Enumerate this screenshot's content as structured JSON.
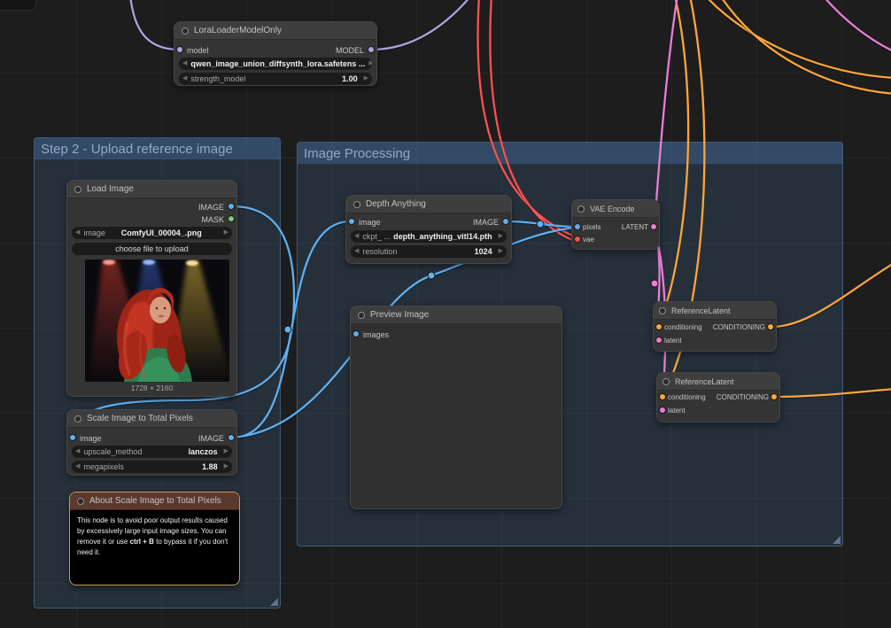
{
  "groups": {
    "step2": {
      "title": "Step 2 - Upload reference image"
    },
    "processing": {
      "title": "Image Processing"
    }
  },
  "nodes": {
    "lora": {
      "title": "LoraLoaderModelOnly",
      "input_model": "model",
      "output_model": "MODEL",
      "widget_lora_value": "qwen_image_union_diffsynth_lora.safetens ...",
      "widget_strength_label": "strength_model",
      "widget_strength_value": "1.00"
    },
    "load_image": {
      "title": "Load Image",
      "output_image": "IMAGE",
      "output_mask": "MASK",
      "widget_image_label": "image",
      "widget_image_value": "ComfyUI_00004_.png",
      "upload_button": "choose file to upload",
      "resolution_caption": "1728 × 2160"
    },
    "scale": {
      "title": "Scale Image to Total Pixels",
      "input_image": "image",
      "output_image": "IMAGE",
      "widget_method_label": "upscale_method",
      "widget_method_value": "lanczos",
      "widget_megapixels_label": "megapixels",
      "widget_megapixels_value": "1.88"
    },
    "about": {
      "title": "About Scale Image to Total Pixels",
      "body_pre": "This node is to avoid poor output results caused by excessively large input image sizes. You can remove it or use ",
      "body_shortcut": "ctrl + B",
      "body_post": " to bypass it if you don't need it."
    },
    "depth": {
      "title": "Depth Anything",
      "input_image": "image",
      "output_image": "IMAGE",
      "widget_ckpt_label": "ckpt_ ...",
      "widget_ckpt_value": "depth_anything_vitl14.pth",
      "widget_resolution_label": "resolution",
      "widget_resolution_value": "1024"
    },
    "preview": {
      "title": "Preview Image",
      "input_images": "images"
    },
    "vae": {
      "title": "VAE Encode",
      "input_pixels": "pixels",
      "input_vae": "vae",
      "output_latent": "LATENT"
    },
    "ref1": {
      "title": "ReferenceLatent",
      "input_conditioning": "conditioning",
      "input_latent": "latent",
      "output_conditioning": "CONDITIONING"
    },
    "ref2": {
      "title": "ReferenceLatent",
      "input_conditioning": "conditioning",
      "input_latent": "latent",
      "output_conditioning": "CONDITIONING"
    }
  },
  "colors": {
    "model_wire": "#b0a0e0",
    "image_wire": "#5fb0f0",
    "mask_slot": "#7ec87e",
    "vae_wire": "#ff5252",
    "latent_wire": "#ea7fd6",
    "conditioning_wire": "#ffa63d",
    "group_title": "#93a9bf"
  }
}
